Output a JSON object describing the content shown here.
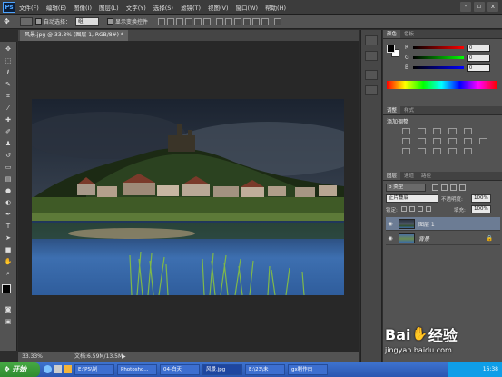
{
  "app": {
    "logo": "Ps"
  },
  "menu": [
    "文件(F)",
    "编辑(E)",
    "图像(I)",
    "图层(L)",
    "文字(Y)",
    "选择(S)",
    "滤镜(T)",
    "视图(V)",
    "窗口(W)",
    "帮助(H)"
  ],
  "window_controls": [
    "-",
    "▫",
    "x"
  ],
  "options": {
    "auto_select_label": "自动选择：",
    "auto_select_value": "组",
    "show_transform_label": "显示变换控件"
  },
  "document": {
    "tab_title": "风景.jpg @ 33.3% (图层 1, RGB/8#) *"
  },
  "status": {
    "zoom": "33.33%",
    "doc_size": "文档:6.59M/13.5M"
  },
  "color_panel": {
    "tabs": [
      "颜色",
      "色板"
    ],
    "channels": [
      {
        "ch": "R",
        "value": "0",
        "color": "#e33"
      },
      {
        "ch": "G",
        "value": "0",
        "color": "#3c3"
      },
      {
        "ch": "B",
        "value": "0",
        "color": "#44f"
      }
    ]
  },
  "adjust_panel": {
    "tabs": [
      "调整",
      "样式"
    ],
    "title": "添加调整"
  },
  "layers_panel": {
    "tabs": [
      "图层",
      "通道",
      "路径"
    ],
    "filter_kind": "ρ 类型",
    "blend_mode": "正片叠底",
    "opacity_label": "不透明度:",
    "opacity_value": "100%",
    "lock_label": "锁定:",
    "fill_label": "填充:",
    "fill_value": "100%",
    "layers": [
      {
        "name": "图层 1",
        "selected": true
      },
      {
        "name": "背景",
        "selected": false
      }
    ]
  },
  "taskbar": {
    "start": "开始",
    "items": [
      "E:\\PS\\制",
      "Photosho...",
      "04-白天",
      "风景.jpg",
      "E:\\23\\未",
      "gx制作白"
    ],
    "clock": "16:38"
  },
  "watermark": {
    "brand": "Bai",
    "brand2": "经验",
    "url": "jingyan.baidu.com"
  }
}
